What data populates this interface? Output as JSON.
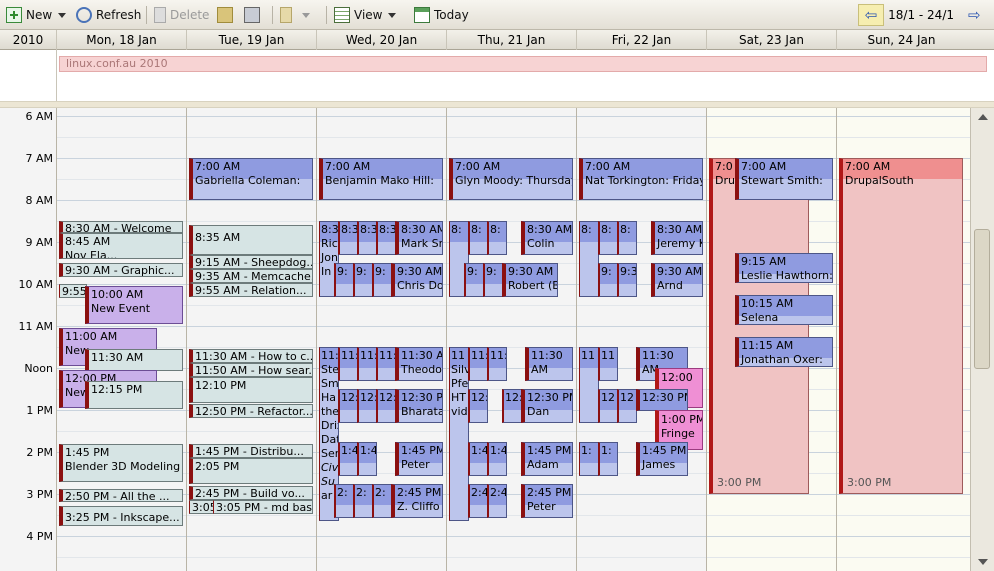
{
  "toolbar": {
    "new_label": "New",
    "refresh_label": "Refresh",
    "delete_label": "Delete",
    "view_label": "View",
    "today_label": "Today",
    "range_label": "18/1 - 24/1"
  },
  "header": {
    "year": "2010",
    "days": [
      "Mon, 18 Jan",
      "Tue, 19 Jan",
      "Wed, 20 Jan",
      "Thu, 21 Jan",
      "Fri, 22 Jan",
      "Sat, 23 Jan",
      "Sun, 24 Jan"
    ]
  },
  "allday": {
    "event": "linux.conf.au 2010"
  },
  "times": [
    "6 AM",
    "7 AM",
    "8 AM",
    "9 AM",
    "10 AM",
    "11 AM",
    "Noon",
    "1 PM",
    "2 PM",
    "3 PM",
    "4 PM"
  ],
  "events": {
    "mon": {
      "e1": "8:30 AM - Welcome",
      "e2a": "8:45 AM",
      "e2b": "Nov Ela...",
      "e3": "9:30 AM - Graphic...",
      "e4": "9:55",
      "e5a": "10:00 AM",
      "e5b": "New Event",
      "e6a": "11:00 AM",
      "e6b": "New",
      "e7": "11:30 AM",
      "e8a": "12:00 PM",
      "e8b": "New",
      "e9": "12:15 PM",
      "e10a": "1:45 PM",
      "e10b": "Blender 3D Modeling",
      "e11": "2:50 PM - All the ...",
      "e12": "3:25 PM - Inkscape..."
    },
    "tue": {
      "e1a": "7:00 AM",
      "e1b": "Gabriella Coleman:",
      "e2": "8:35 AM",
      "e3": "9:15 AM - Sheepdog...",
      "e4": "9:35 AM - Memcache...",
      "e5": "9:55 AM - Relation...",
      "e6": "11:30 AM - How to c...",
      "e7": "11:50 AM - How sear...",
      "e8": "12:10 PM",
      "e9": "12:50 PM - Refactor...",
      "e10": "1:45 PM - Distribu...",
      "e11": "2:05 PM",
      "e12": "2:45 PM - Build vo...",
      "e13a": "3:05",
      "e13b": "3:05 PM - md based"
    },
    "wed": {
      "e1a": "7:00 AM",
      "e1b": "Benjamin Mako Hill:",
      "s1": "8:3",
      "s2": "8:3",
      "s3": "8:3",
      "s4": "8:3",
      "s5": "8:30 AM",
      "n1": "Ric",
      "n2": "Jonas",
      "n3": "In",
      "n4": "Mark Smi",
      "t1": "9:",
      "t2": "9:",
      "t3": "9:",
      "t4": "9:30 AM",
      "c1": "Chris Dou",
      "a1": "11:",
      "a2": "11:",
      "a3": "11:",
      "a4": "11:",
      "a5": "11:30 AM",
      "a6": "Theodore",
      "st1": "Ste",
      "st2": "Smith",
      "st3": "Ha",
      "st4": "the",
      "st5": "Drizzle",
      "st6": "Dat",
      "st7": "Ser",
      "st8": "Civic",
      "st9": "Su",
      "st10": "ar",
      "b1": "12:",
      "b2": "12:",
      "b3": "12:",
      "b4": "12:30 PM",
      "b5": "Bharata F",
      "p1": "1:4",
      "p2": "1:4",
      "p3": "1:45 PM",
      "p4": "Peter",
      "q1": "2:",
      "q2": "2:",
      "q3": "2:",
      "q4": "2:45 PM",
      "q5": "Z. Cliffo"
    },
    "thu": {
      "e1a": "7:00 AM",
      "e1b": "Glyn Moody: Thursday",
      "s1": "8:",
      "s2": "8:",
      "s3": "8:",
      "s4": "8:30 AM",
      "n1": "Colin",
      "t1": "9:",
      "t2": "9:",
      "t3": "9:30 AM",
      "c1": "Robert (B",
      "a1": "11",
      "a2": "11:",
      "a3": "11:",
      "a4": "11:30",
      "a5": "AM",
      "sv1": "Silvia",
      "sv2": "Pfe",
      "sv3": "HT",
      "sv4": "video:",
      "b1": "12:",
      "b2": "12:",
      "b3": "12:30 PM",
      "b4": "Dan",
      "p1": "1:4",
      "p2": "1:4",
      "p3": "1:45 PM",
      "p4": "Adam",
      "q1": "2:4",
      "q2": "2:4",
      "q3": "2:45 PM",
      "q4": "Peter"
    },
    "fri": {
      "e1a": "7:00 AM",
      "e1b": "Nat Torkington: Friday",
      "s1": "8:",
      "s2": "8:",
      "s3": "8:",
      "s4": "8:30 AM",
      "n1": "Jeremy K",
      "t1": "9:",
      "t2": "9:3",
      "t3": "9:30 AM",
      "c1": "Arnd",
      "a1": "11",
      "a2": "11",
      "a3": "11:30",
      "a4": "AM",
      "m1": "12:00",
      "b1": "12",
      "b2": "12",
      "b3": "12:30 PM",
      "m2a": "1:00 PM",
      "m2b": "Fringe",
      "p1": "1:",
      "p2": "1:",
      "p3": "1:45 PM",
      "p4": "James"
    },
    "sat": {
      "e1a": "7:0",
      "e1b": "Dru",
      "e1end": "3:00 PM",
      "e2a": "7:00 AM",
      "e2b": "Stewart Smith:",
      "e3a": "9:15 AM",
      "e3b": "Leslie Hawthorn:",
      "e4a": "10:15 AM",
      "e4b": "Selena",
      "e5a": "11:15 AM",
      "e5b": "Jonathan Oxer:"
    },
    "sun": {
      "e1a": "7:00 AM",
      "e1b": "DrupalSouth",
      "e1end": "3:00 PM"
    }
  },
  "colors": {
    "event_blue": "#bcc5ec",
    "event_teal": "#d6e4e4",
    "event_purple": "#c9b0ea",
    "event_pink": "#f0c3c3",
    "event_magenta": "#ef8fd4",
    "event_marker": "#a51d1d"
  }
}
